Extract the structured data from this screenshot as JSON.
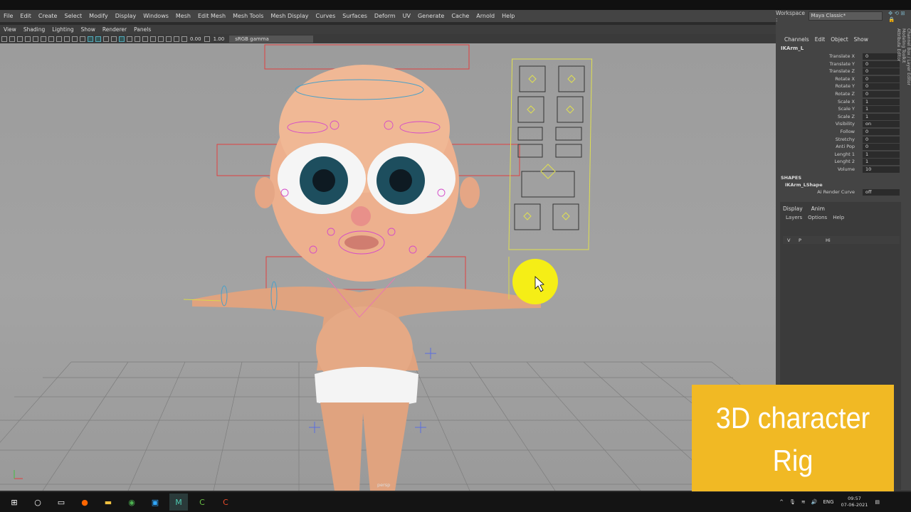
{
  "menu_bar": [
    "File",
    "Edit",
    "Create",
    "Select",
    "Modify",
    "Display",
    "Windows",
    "Mesh",
    "Edit Mesh",
    "Mesh Tools",
    "Mesh Display",
    "Curves",
    "Surfaces",
    "Deform",
    "UV",
    "Generate",
    "Cache",
    "Arnold",
    "Help"
  ],
  "workspace": {
    "label": "Workspace :",
    "value": "Maya Classic*"
  },
  "panel_menu": [
    "View",
    "Shading",
    "Lighting",
    "Show",
    "Renderer",
    "Panels"
  ],
  "viewport_toolbar": {
    "field1": "0.00",
    "field2": "1.00",
    "colorspace": "sRGB gamma"
  },
  "viewport": {
    "camera_label": "persp"
  },
  "channel_box": {
    "menu": [
      "Channels",
      "Edit",
      "Object",
      "Show"
    ],
    "object": "IKArm_L",
    "channels": [
      {
        "name": "Translate X",
        "value": "0"
      },
      {
        "name": "Translate Y",
        "value": "0"
      },
      {
        "name": "Translate Z",
        "value": "0"
      },
      {
        "name": "Rotate X",
        "value": "0"
      },
      {
        "name": "Rotate Y",
        "value": "0"
      },
      {
        "name": "Rotate Z",
        "value": "0"
      },
      {
        "name": "Scale X",
        "value": "1"
      },
      {
        "name": "Scale Y",
        "value": "1"
      },
      {
        "name": "Scale Z",
        "value": "1"
      },
      {
        "name": "Visibility",
        "value": "on"
      },
      {
        "name": "Follow",
        "value": "0"
      },
      {
        "name": "Stretchy",
        "value": "0"
      },
      {
        "name": "Anti Pop",
        "value": "0"
      },
      {
        "name": "Lenght 1",
        "value": "1"
      },
      {
        "name": "Lenght 2",
        "value": "1"
      },
      {
        "name": "Volume",
        "value": "10"
      }
    ],
    "shapes_header": "SHAPES",
    "shape_name": "IKArm_LShape",
    "ai_render_curve": {
      "name": "Ai Render Curve",
      "value": "off"
    }
  },
  "side_tabs": [
    "Channel Box / Layer Editor",
    "Modeling Toolkit",
    "Attribute Editor"
  ],
  "layer_editor": {
    "tabs": [
      "Display",
      "Anim"
    ],
    "menu": [
      "Layers",
      "Options",
      "Help"
    ],
    "row": {
      "v": "V",
      "p": "P",
      "name": "Hi"
    }
  },
  "caption": {
    "line1": "3D character",
    "line2": "Rig"
  },
  "taskbar": {
    "lang": "ENG",
    "time": "09:57",
    "date": "07-06-2021"
  }
}
